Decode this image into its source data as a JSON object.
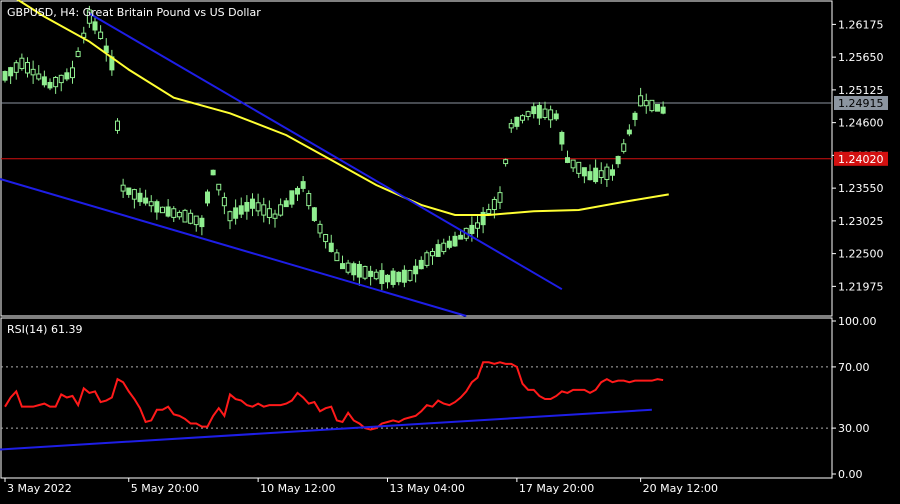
{
  "header": {
    "symbol": "GBPUSD",
    "timeframe": "H4",
    "description": "Great Britain Pound vs US Dollar",
    "title": "GBPUSD, H4:  Great Britain Pound vs US Dollar"
  },
  "colors": {
    "background": "#000000",
    "bull_candle": "#90ee90",
    "ma_line": "#ffff33",
    "trendline": "#1e1ee6",
    "rsi_line": "#ff1a1a",
    "bid_line": "#8c95a0",
    "red_line": "#d21010",
    "frame": "#ffffff"
  },
  "chart_data": [
    {
      "type": "candlestick",
      "title": "GBPUSD, H4:  Great Britain Pound vs US Dollar",
      "ylim": [
        1.215,
        1.2655
      ],
      "y_ticks": [
        "1.26175",
        "1.25650",
        "1.25125",
        "1.24600",
        "1.24075",
        "1.23550",
        "1.23025",
        "1.22500",
        "1.21975"
      ],
      "x_ticks": [
        "3 May 2022",
        "5 May 20:00",
        "10 May 12:00",
        "13 May 04:00",
        "17 May 20:00",
        "20 May 12:00"
      ],
      "current_price": "1.24915",
      "red_price": "1.24020",
      "moving_average_approx": [
        {
          "bar": 0,
          "value": 1.267
        },
        {
          "bar": 7,
          "value": 1.263
        },
        {
          "bar": 15,
          "value": 1.259
        },
        {
          "bar": 22,
          "value": 1.2545
        },
        {
          "bar": 30,
          "value": 1.25
        },
        {
          "bar": 40,
          "value": 1.2475
        },
        {
          "bar": 50,
          "value": 1.244
        },
        {
          "bar": 58,
          "value": 1.24
        },
        {
          "bar": 66,
          "value": 1.236
        },
        {
          "bar": 74,
          "value": 1.2328
        },
        {
          "bar": 80,
          "value": 1.2312
        },
        {
          "bar": 86,
          "value": 1.2312
        },
        {
          "bar": 94,
          "value": 1.2318
        },
        {
          "bar": 102,
          "value": 1.232
        },
        {
          "bar": 110,
          "value": 1.2333
        },
        {
          "bar": 118,
          "value": 1.2345
        }
      ],
      "trendlines": [
        {
          "from": {
            "bar": -1,
            "price": 1.237
          },
          "to": {
            "bar": 82,
            "price": 1.215
          }
        },
        {
          "from": {
            "bar": 15,
            "price": 1.2635
          },
          "to": {
            "bar": 99,
            "price": 1.2193
          }
        }
      ]
    },
    {
      "type": "line",
      "title": "RSI(14) 61.39",
      "indicator": "RSI(14)",
      "last_value": "61.39",
      "ylim": [
        0,
        100
      ],
      "y_ticks": [
        "100.00",
        "70.00",
        "30.00",
        "0.00"
      ],
      "levels": [
        70,
        30
      ],
      "series": [
        {
          "name": "RSI(14)",
          "values": [
            44,
            50,
            54,
            44,
            44,
            44,
            45,
            46,
            44,
            44,
            52,
            50,
            51,
            45,
            56,
            53,
            54,
            47,
            48,
            50,
            62,
            60,
            54,
            49,
            43,
            34,
            35,
            42,
            42,
            44,
            39,
            38,
            36,
            33,
            33,
            31,
            31,
            38,
            43,
            38,
            52,
            49,
            48,
            45,
            44,
            46,
            44,
            45,
            45,
            45,
            46,
            48,
            53,
            50,
            46,
            47,
            41,
            43,
            44,
            35,
            34,
            40,
            35,
            33,
            30,
            29,
            30,
            33,
            34,
            35,
            34,
            36,
            37,
            38,
            41,
            45,
            44,
            48,
            46,
            45,
            47,
            50,
            54,
            60,
            63,
            73,
            73,
            72,
            73,
            72,
            72,
            70,
            59,
            55,
            55,
            51,
            49,
            49,
            51,
            54,
            53,
            55,
            55,
            55,
            53,
            55,
            60,
            62,
            60,
            61,
            61,
            60,
            61,
            61,
            61,
            61,
            62,
            61.39
          ]
        },
        {
          "name": "trendline",
          "from": {
            "bar": -1,
            "value": 16
          },
          "to": {
            "bar": 115,
            "value": 42
          }
        }
      ]
    }
  ]
}
